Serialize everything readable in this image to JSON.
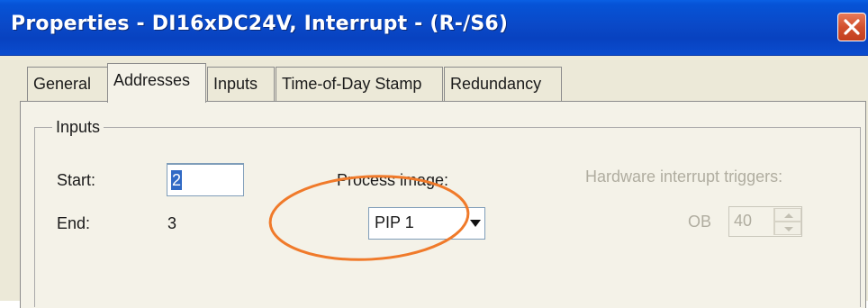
{
  "window": {
    "title": "Properties - DI16xDC24V, Interrupt - (R-/S6)"
  },
  "tabs": [
    {
      "label": "General",
      "active": false
    },
    {
      "label": "Addresses",
      "active": true
    },
    {
      "label": "Inputs",
      "active": false
    },
    {
      "label": "Time-of-Day Stamp",
      "active": false
    },
    {
      "label": "Redundancy",
      "active": false
    }
  ],
  "inputs_group": {
    "title": "Inputs",
    "start_label": "Start:",
    "start_value": "2",
    "end_label": "End:",
    "end_value": "3",
    "process_image_label": "Process image:",
    "process_image_value": "PIP 1",
    "hw_interrupt_label": "Hardware interrupt triggers:",
    "ob_label": "OB",
    "ob_value": "40"
  },
  "icons": {
    "close": "close-icon",
    "dropdown": "chevron-down-icon",
    "spin_up": "arrow-up-icon",
    "spin_down": "arrow-down-icon"
  },
  "colors": {
    "titlebar": "#0a49c8",
    "annotation": "#f07a2a",
    "selection": "#316ac5"
  }
}
